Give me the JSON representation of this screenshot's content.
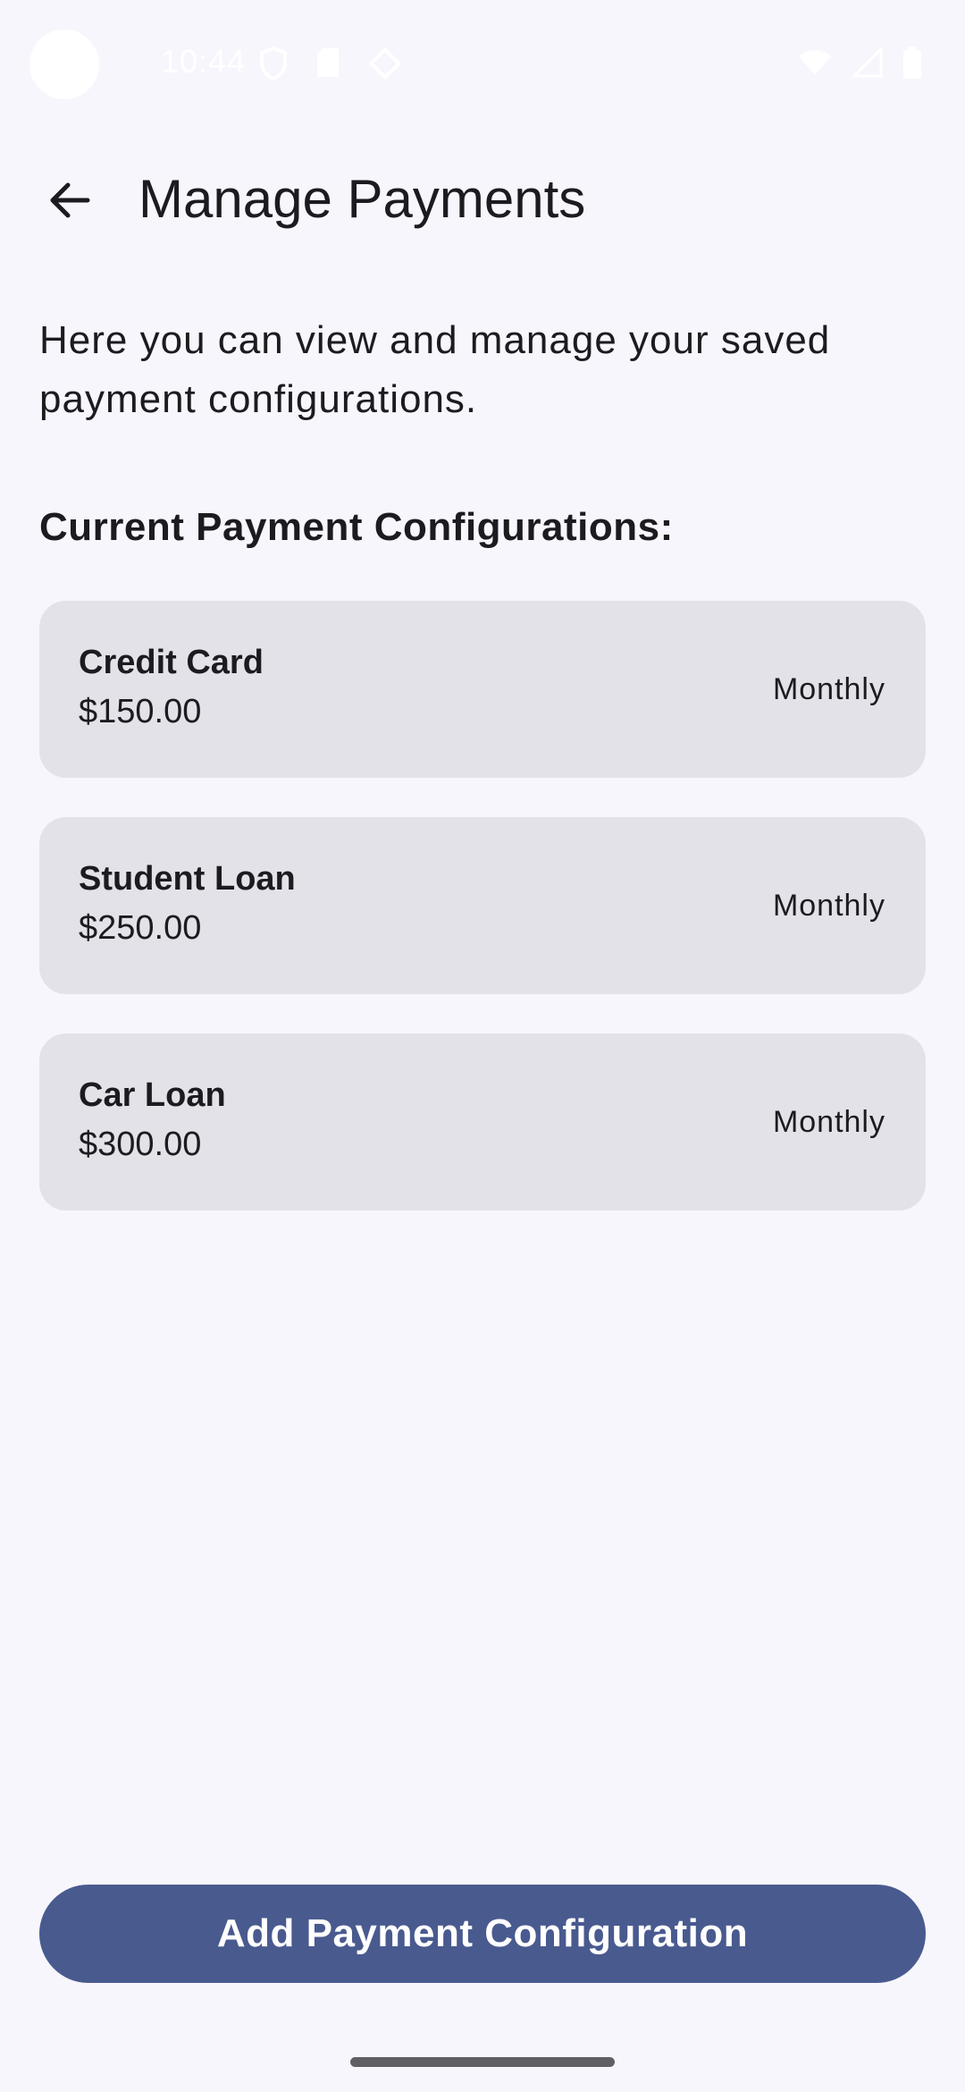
{
  "status_bar": {
    "time": "10:44",
    "icons": [
      "shield-icon",
      "sd-card-icon",
      "data-saver-icon",
      "wifi-icon",
      "cellular-signal-icon",
      "battery-icon"
    ]
  },
  "header": {
    "back_icon": "arrow-back-icon",
    "title": "Manage Payments"
  },
  "intro": {
    "text": "Here you can view and manage your saved payment configurations."
  },
  "section": {
    "title": "Current Payment Configurations:"
  },
  "payments": [
    {
      "name": "Credit Card",
      "amount": "$150.00",
      "frequency": "Monthly"
    },
    {
      "name": "Student Loan",
      "amount": "$250.00",
      "frequency": "Monthly"
    },
    {
      "name": "Car Loan",
      "amount": "$300.00",
      "frequency": "Monthly"
    }
  ],
  "actions": {
    "add_label": "Add Payment Configuration"
  },
  "colors": {
    "background": "#f7f6fc",
    "card": "#e3e2e8",
    "primary": "#495a8f",
    "on_primary": "#ffffff",
    "text": "#1c1b1f"
  }
}
